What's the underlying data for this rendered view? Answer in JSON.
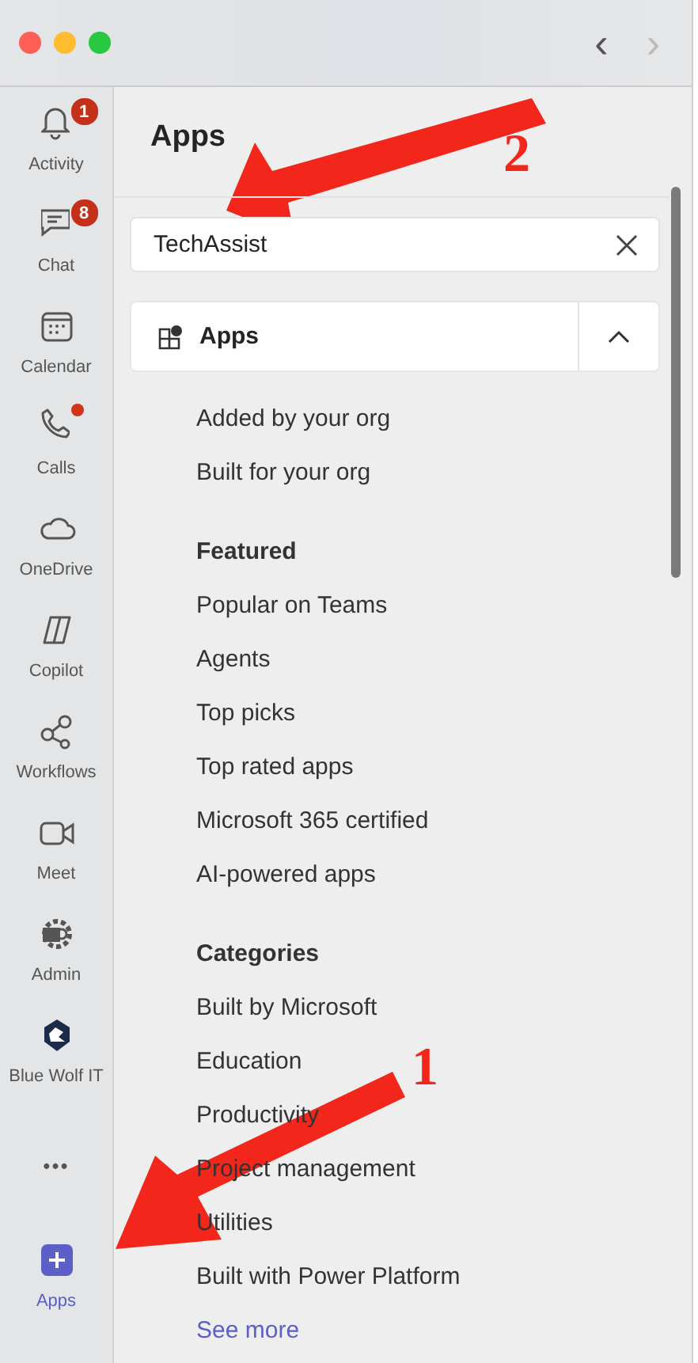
{
  "window": {
    "nav_back": "‹",
    "nav_forward": "›"
  },
  "rail": [
    {
      "kind": "bell",
      "label": "Activity",
      "badge": "1",
      "dot": false,
      "selected": false
    },
    {
      "kind": "chat",
      "label": "Chat",
      "badge": "8",
      "dot": false,
      "selected": false
    },
    {
      "kind": "calendar",
      "label": "Calendar",
      "dot": false,
      "selected": false
    },
    {
      "kind": "phone",
      "label": "Calls",
      "dot": true,
      "selected": false
    },
    {
      "kind": "cloud",
      "label": "OneDrive",
      "dot": false,
      "selected": false
    },
    {
      "kind": "copilot",
      "label": "Copilot",
      "dot": false,
      "selected": false
    },
    {
      "kind": "workflow",
      "label": "Workflows",
      "dot": false,
      "selected": false
    },
    {
      "kind": "video",
      "label": "Meet",
      "dot": false,
      "selected": false
    },
    {
      "kind": "gear",
      "label": "Admin",
      "dot": false,
      "selected": false
    },
    {
      "kind": "shield",
      "label": "Blue Wolf IT",
      "dot": false,
      "selected": false
    },
    {
      "kind": "more",
      "label": "•••",
      "dot": false,
      "selected": false
    },
    {
      "kind": "plus",
      "label": "Apps",
      "dot": false,
      "selected": true
    }
  ],
  "panel": {
    "title": "Apps",
    "search": {
      "value": "TechAssist"
    },
    "section": {
      "title": "Apps",
      "expanded": true
    },
    "groups": [
      {
        "items": [
          "Added by your org",
          "Built for your org"
        ]
      },
      {
        "heading": "Featured",
        "items": [
          "Popular on Teams",
          "Agents",
          "Top picks",
          "Top rated apps",
          "Microsoft 365 certified",
          "AI-powered apps"
        ]
      },
      {
        "heading": "Categories",
        "items": [
          "Built by Microsoft",
          "Education",
          "Productivity",
          "Project management",
          "Utilities",
          "Built with Power Platform"
        ],
        "see_more": "See more"
      }
    ]
  },
  "annotations": [
    {
      "label": "2"
    },
    {
      "label": "1"
    }
  ]
}
